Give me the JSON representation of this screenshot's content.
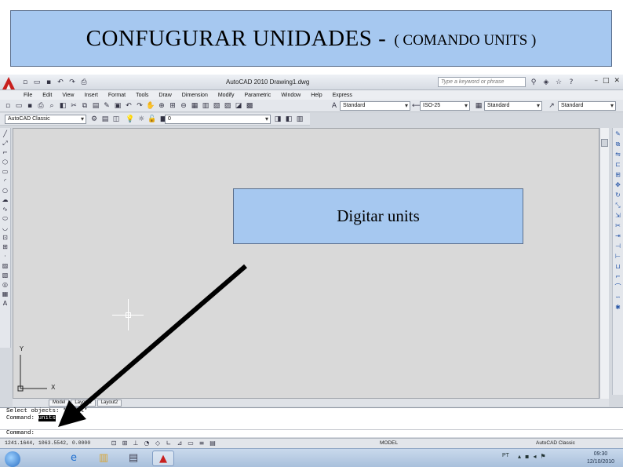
{
  "slide": {
    "title_main": "CONFUGURAR  UNIDADES - ",
    "title_sub": "( COMANDO UNITS )",
    "callout_text": "Digitar units"
  },
  "autocad": {
    "window_title": "AutoCAD 2010    Drawing1.dwg",
    "search_placeholder": "Type a keyword or phrase",
    "menu": [
      "File",
      "Edit",
      "View",
      "Insert",
      "Format",
      "Tools",
      "Draw",
      "Dimension",
      "Modify",
      "Parametric",
      "Window",
      "Help",
      "Express"
    ],
    "toolbar_dropdowns": {
      "text_style": "Standard",
      "dim_style": "ISO-25",
      "table_style": "Standard",
      "mleader_style": "Standard",
      "workspace": "AutoCAD Classic",
      "layer": "0"
    },
    "layout_tabs": [
      "Model",
      "Layout1",
      "Layout2"
    ],
    "command_history": [
      {
        "before": "Select objects: ",
        "highlight": "",
        "after": "*Model*"
      },
      {
        "before": "Command: ",
        "highlight": "units",
        "after": ""
      }
    ],
    "command_prompt": "Command:",
    "coordinates": "1241.1644, 1063.5542, 0.0000",
    "status_model": "MODEL",
    "status_workspace": "AutoCAD Classic",
    "ucs_y": "Y",
    "ucs_x": "X"
  },
  "taskbar": {
    "language": "PT",
    "time": "09:30",
    "date": "12/10/2010"
  },
  "colors": {
    "slide_box": "#a6c8f0",
    "drawing_area": "#d9d9d9",
    "arrow": "#000000"
  },
  "icons": [
    "windows-start-icon",
    "ie-icon",
    "explorer-icon",
    "documents-icon",
    "autocad-icon"
  ]
}
